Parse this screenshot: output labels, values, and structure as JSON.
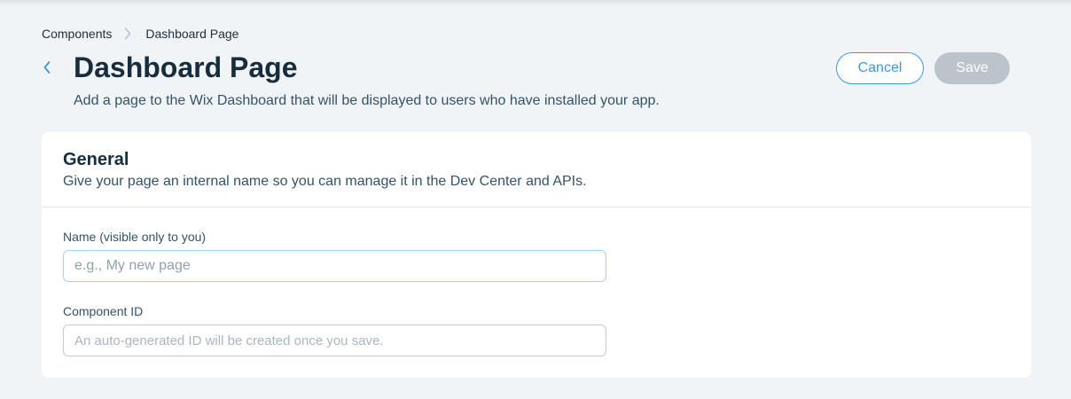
{
  "breadcrumb": {
    "parent": "Components",
    "current": "Dashboard Page"
  },
  "header": {
    "title": "Dashboard Page",
    "subtitle": "Add a page to the Wix Dashboard that will be displayed to users who have installed your app.",
    "cancel_label": "Cancel",
    "save_label": "Save"
  },
  "general": {
    "title": "General",
    "description": "Give your page an internal name so you can manage it in the Dev Center and APIs.",
    "name_field": {
      "label": "Name (visible only to you)",
      "value": "",
      "placeholder": "e.g., My new page"
    },
    "component_id_field": {
      "label": "Component ID",
      "value": "",
      "placeholder": "An auto-generated ID will be created once you save."
    }
  },
  "icons": {
    "back": "chevron-left-icon",
    "breadcrumb_separator": "chevron-right-icon"
  },
  "colors": {
    "accent": "#3899ec",
    "disabled_button": "#bcc4cb",
    "background": "#f0f4f7",
    "title_text": "#162d3d"
  }
}
